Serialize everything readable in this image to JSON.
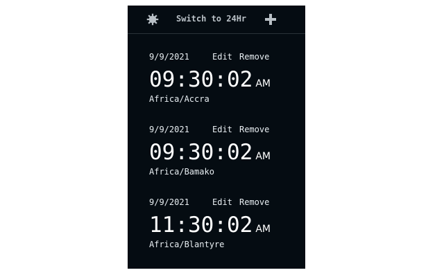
{
  "topbar": {
    "settings_icon": "gear-icon",
    "toggle_label": "Switch to 24Hr",
    "add_icon": "plus-icon"
  },
  "clocks": [
    {
      "date": "9/9/2021",
      "edit_label": "Edit",
      "remove_label": "Remove",
      "time": "09:30:02",
      "ampm": "AM",
      "timezone": "Africa/Accra"
    },
    {
      "date": "9/9/2021",
      "edit_label": "Edit",
      "remove_label": "Remove",
      "time": "09:30:02",
      "ampm": "AM",
      "timezone": "Africa/Bamako"
    },
    {
      "date": "9/9/2021",
      "edit_label": "Edit",
      "remove_label": "Remove",
      "time": "11:30:02",
      "ampm": "AM",
      "timezone": "Africa/Blantyre"
    }
  ],
  "colors": {
    "panel_bg": "#050c12",
    "text": "#e8eef2",
    "muted": "#b9c0c6"
  }
}
